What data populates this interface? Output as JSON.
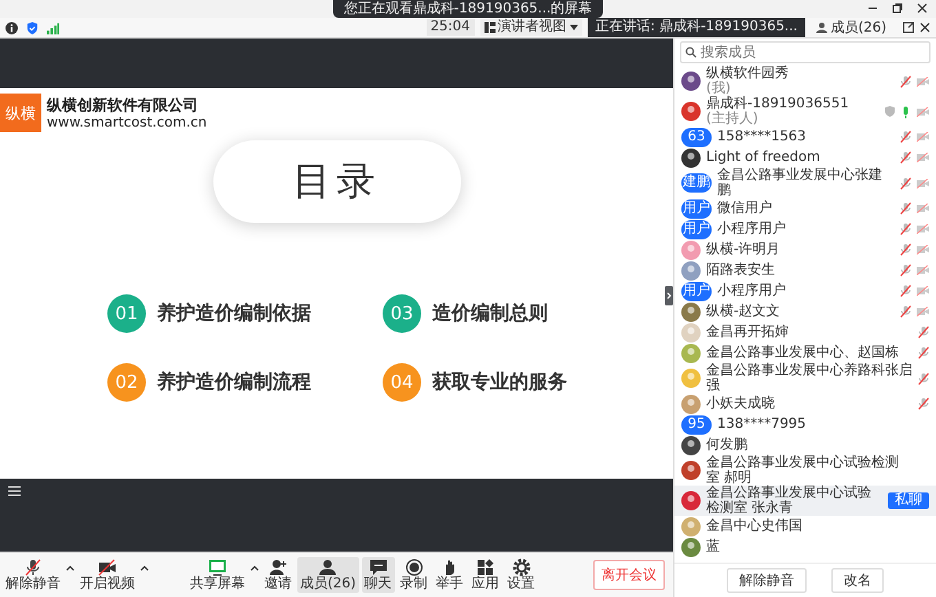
{
  "window": {
    "banner": "您正在观看鼎成科-189190365...的屏幕"
  },
  "toolbar": {
    "timer": "25:04",
    "view_button": "演讲者视图",
    "speaking": "正在讲话: 鼎成科-189190365...",
    "members_tab": "成员(26)"
  },
  "slide": {
    "logo": "纵横",
    "company": "纵横创新软件有限公司",
    "url": "www.smartcost.com.cn",
    "heading": "目录",
    "items": [
      {
        "number": "01",
        "text": "养护造价编制依据",
        "color": "#1bb08a"
      },
      {
        "number": "02",
        "text": "养护造价编制流程",
        "color": "#f7931e"
      },
      {
        "number": "03",
        "text": "造价编制总则",
        "color": "#1bb08a"
      },
      {
        "number": "04",
        "text": "获取专业的服务",
        "color": "#f7931e"
      }
    ]
  },
  "participants": {
    "search": {
      "placeholder": "搜索成员"
    },
    "members": [
      {
        "name": "纵横软件园秀",
        "note": "(我)",
        "avatar": {
          "kind": "image",
          "color": "#6b4a8a"
        },
        "muted": true,
        "camera_off": true,
        "shield": false,
        "highlighted": false
      },
      {
        "name": "鼎成科-18919036551",
        "note": "(主持人)",
        "avatar": {
          "kind": "image",
          "color": "#d9342b"
        },
        "muted": false,
        "camera_off": true,
        "shield": true,
        "highlighted": false
      },
      {
        "name": "158****1563",
        "avatar": {
          "kind": "text",
          "text": "63"
        },
        "muted": true,
        "camera_off": true,
        "shield": false,
        "highlighted": false
      },
      {
        "name": "Light of freedom",
        "avatar": {
          "kind": "image",
          "color": "#333333"
        },
        "muted": true,
        "camera_off": true,
        "shield": false,
        "highlighted": false
      },
      {
        "name": "金昌公路事业发展中心张建鹏",
        "avatar": {
          "kind": "text",
          "text": "建鹏"
        },
        "muted": true,
        "camera_off": true,
        "shield": false,
        "highlighted": false
      },
      {
        "name": "微信用户",
        "avatar": {
          "kind": "text",
          "text": "用户"
        },
        "muted": true,
        "camera_off": true,
        "shield": false,
        "highlighted": false
      },
      {
        "name": "小程序用户",
        "avatar": {
          "kind": "text",
          "text": "用户"
        },
        "muted": true,
        "camera_off": true,
        "shield": false,
        "highlighted": false
      },
      {
        "name": "纵横-许明月",
        "avatar": {
          "kind": "image",
          "color": "#f29bb0"
        },
        "muted": true,
        "camera_off": true,
        "shield": false,
        "highlighted": false
      },
      {
        "name": "陌路表安生",
        "avatar": {
          "kind": "image",
          "color": "#8fa0c0"
        },
        "muted": true,
        "camera_off": true,
        "shield": false,
        "highlighted": false
      },
      {
        "name": "小程序用户",
        "avatar": {
          "kind": "text",
          "text": "用户"
        },
        "muted": true,
        "camera_off": true,
        "shield": false,
        "highlighted": false
      },
      {
        "name": "纵横-赵文文",
        "avatar": {
          "kind": "image",
          "color": "#8a7a4a"
        },
        "muted": true,
        "camera_off": true,
        "shield": false,
        "highlighted": false
      },
      {
        "name": "金昌再开拓婶",
        "avatar": {
          "kind": "image",
          "color": "#e0d2c0"
        },
        "muted": true,
        "camera_off": false,
        "shield": false,
        "highlighted": false
      },
      {
        "name": "金昌公路事业发展中心、赵国栋",
        "avatar": {
          "kind": "image",
          "color": "#a8b850"
        },
        "muted": true,
        "camera_off": false,
        "shield": false,
        "highlighted": false
      },
      {
        "name": "金昌公路事业发展中心养路科张启强",
        "avatar": {
          "kind": "image",
          "color": "#f0c040"
        },
        "muted": true,
        "camera_off": false,
        "shield": false,
        "highlighted": false
      },
      {
        "name": "小妖夫成晓",
        "avatar": {
          "kind": "image",
          "color": "#c8a070"
        },
        "muted": true,
        "camera_off": false,
        "shield": false,
        "highlighted": false
      },
      {
        "name": "138****7995",
        "avatar": {
          "kind": "text",
          "text": "95"
        },
        "camera_off": false,
        "shield": false,
        "highlighted": false
      },
      {
        "name": "何发鹏",
        "avatar": {
          "kind": "image",
          "color": "#444444"
        },
        "camera_off": false,
        "shield": false,
        "highlighted": false
      },
      {
        "name": "金昌公路事业发展中心试验检测室 郝明",
        "avatar": {
          "kind": "image",
          "color": "#c0402a"
        },
        "camera_off": false,
        "shield": false,
        "highlighted": false
      },
      {
        "name": "金昌公路事业发展中心试验检测室 张永青",
        "avatar": {
          "kind": "image",
          "color": "#d8283a"
        },
        "camera_off": false,
        "shield": false,
        "highlighted": true,
        "action": "私聊"
      },
      {
        "name": "金昌中心史伟国",
        "avatar": {
          "kind": "image",
          "color": "#d0b070"
        },
        "camera_off": false,
        "shield": false,
        "highlighted": false
      },
      {
        "name": "蓝",
        "avatar": {
          "kind": "image",
          "color": "#6a8a40"
        },
        "camera_off": false,
        "shield": false,
        "highlighted": false
      }
    ],
    "buttons": [
      "解除静音",
      "改名"
    ]
  },
  "bottom_bar": {
    "buttons": [
      {
        "label": "解除静音",
        "kind": "mic",
        "caret": true,
        "selected": false
      },
      {
        "label": "开启视频",
        "kind": "video",
        "caret": true,
        "selected": false
      },
      {
        "label": "共享屏幕",
        "kind": "share",
        "caret": true,
        "selected": false
      },
      {
        "label": "邀请",
        "kind": "invite",
        "caret": false,
        "selected": false
      },
      {
        "label": "成员(26)",
        "kind": "members",
        "caret": false,
        "selected": true
      },
      {
        "label": "聊天",
        "kind": "chat",
        "caret": false,
        "selected": true
      },
      {
        "label": "录制",
        "kind": "record",
        "caret": false,
        "selected": false
      },
      {
        "label": "举手",
        "kind": "hand",
        "caret": false,
        "selected": false
      },
      {
        "label": "应用",
        "kind": "apps",
        "caret": false,
        "selected": false
      },
      {
        "label": "设置",
        "kind": "settings",
        "caret": false,
        "selected": false
      }
    ],
    "leave": "离开会议"
  }
}
